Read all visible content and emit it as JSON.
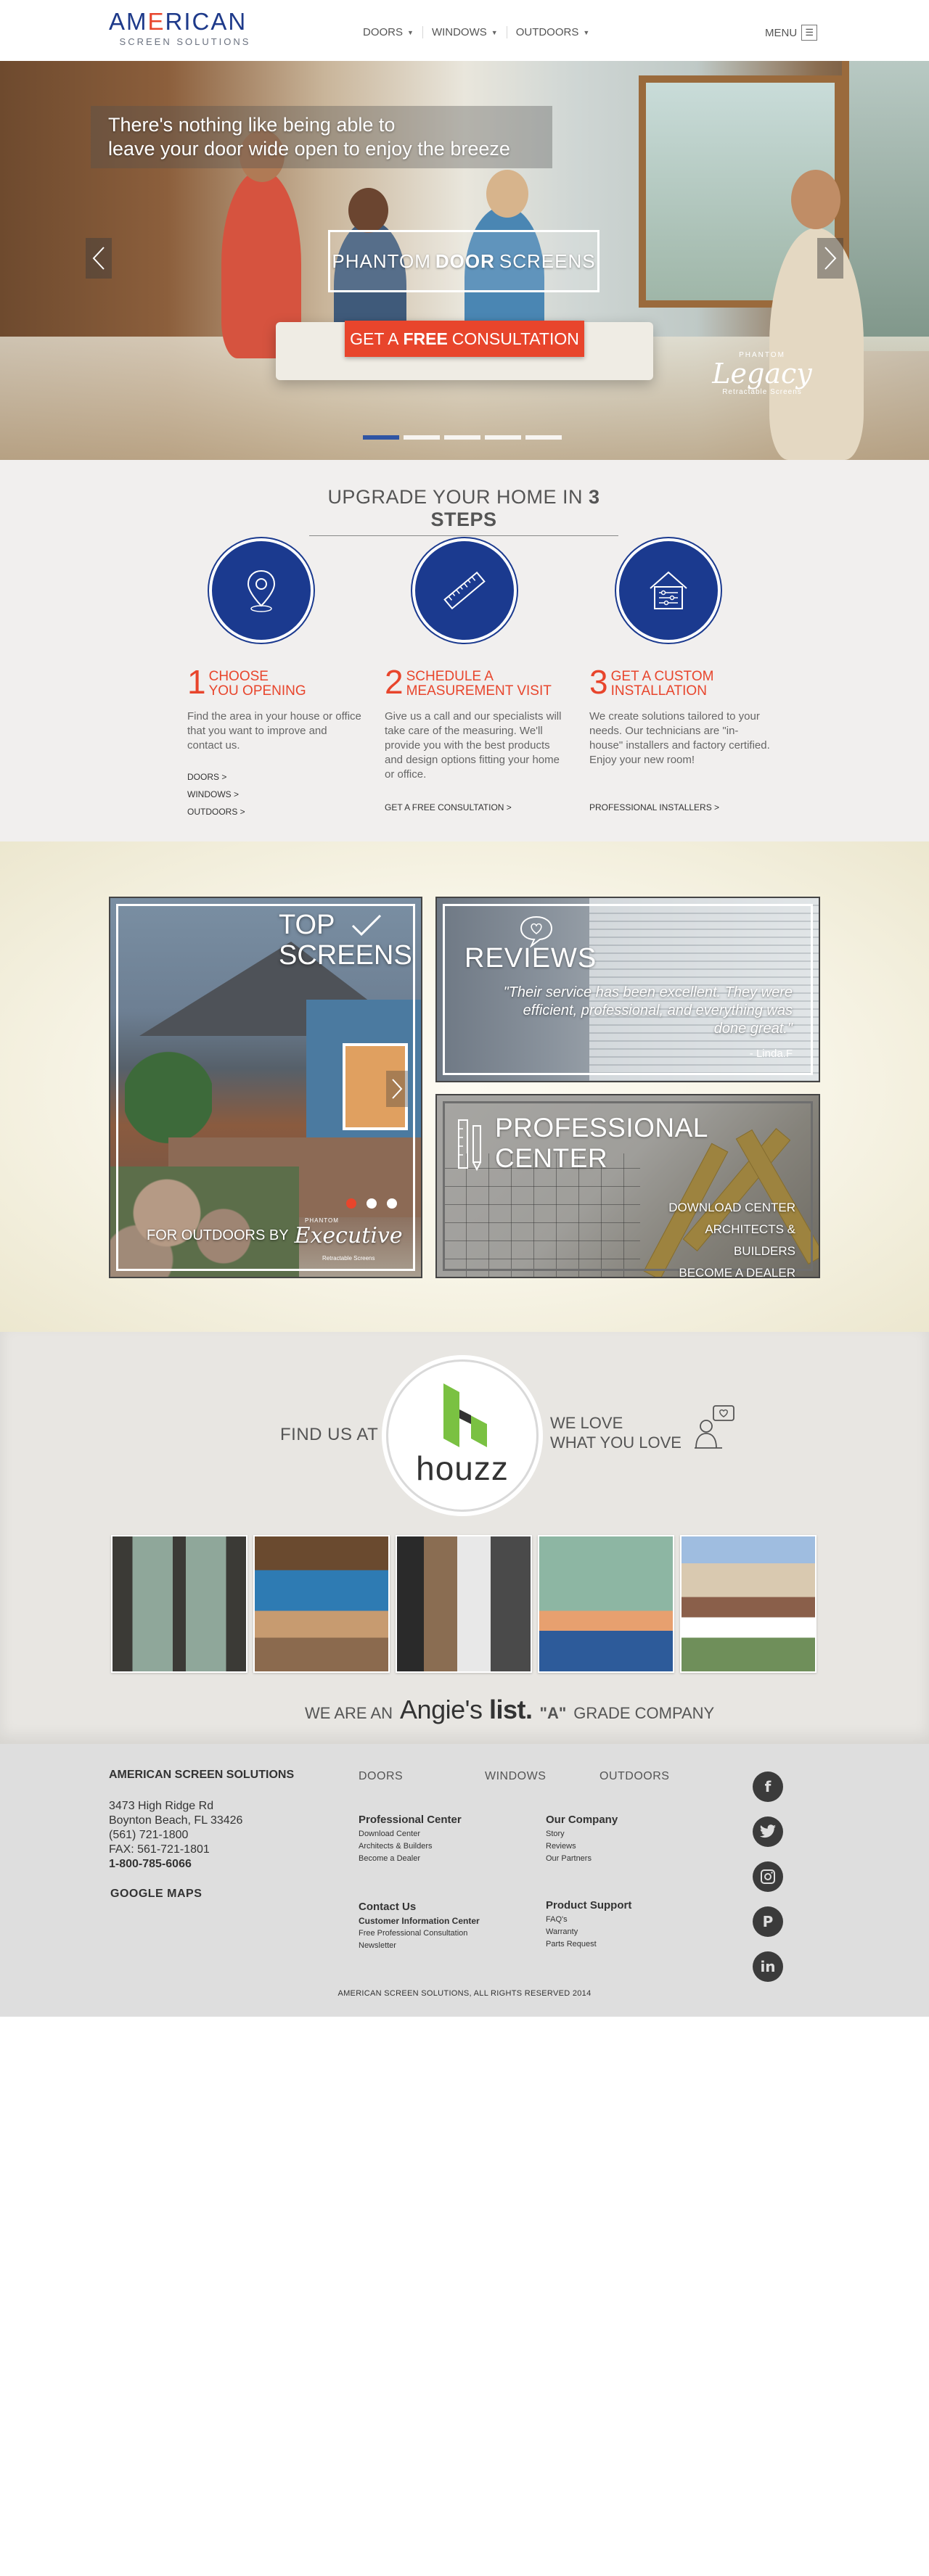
{
  "header": {
    "logo_main_a": "AM",
    "logo_main_e": "E",
    "logo_main_b": "RICAN",
    "logo_sub": "SCREEN SOLUTIONS",
    "nav": [
      "DOORS",
      "WINDOWS",
      "OUTDOORS"
    ],
    "menu_label": "MENU"
  },
  "hero": {
    "caption_line1": "There's nothing like being able to",
    "caption_line2": "leave your door wide open to enjoy the breeze",
    "boxed_a": "PHANTOM",
    "boxed_b": "DOOR",
    "boxed_c": "SCREENS",
    "cta_a": "GET A",
    "cta_b": "FREE",
    "cta_c": "CONSULTATION",
    "legacy_small": "PHANTOM",
    "legacy_big": "Legacy",
    "legacy_tag": "Retractable Screens",
    "slides_total": 5,
    "slide_active": 1
  },
  "steps": {
    "title_a": "UPGRADE YOUR HOME IN",
    "title_b": "3 STEPS",
    "items": [
      {
        "num": "1",
        "head_line1": "CHOOSE",
        "head_line2": "YOU OPENING",
        "desc": "Find the area in your house or office that you want to improve and contact us.",
        "links": [
          "DOORS >",
          "WINDOWS >",
          "OUTDOORS >"
        ],
        "icon": "location-pin-icon"
      },
      {
        "num": "2",
        "head_line1": "SCHEDULE  A",
        "head_line2": "MEASUREMENT VISIT",
        "desc": "Give us a call and our specialists will take care of the measuring. We'll provide you with the best products and design options fitting your home or office.",
        "links": [
          "GET A FREE CONSULTATION  >"
        ],
        "icon": "ruler-icon"
      },
      {
        "num": "3",
        "head_line1": "GET A CUSTOM",
        "head_line2": "INSTALLATION",
        "desc": "We create solutions tailored to your needs. Our technicians are \"in-house\" installers and factory certified. Enjoy your new room!",
        "links": [
          "PROFESSIONAL INSTALLERS >"
        ],
        "icon": "house-settings-icon"
      }
    ]
  },
  "tiles": {
    "top_title_line1": "TOP",
    "top_title_line2": "SCREENS",
    "top_footer": "FOR OUTDOORS BY",
    "exec_small": "PHANTOM",
    "exec_logo": "Executive",
    "exec_tag": "Retractable Screens",
    "top_slides_total": 3,
    "top_slide_active": 1,
    "reviews_title": "REVIEWS",
    "review_quote": "\"Their service has been excellent. They were efficient, professional, and everything was done great.\"",
    "review_author": "- Linda.F",
    "pro_title_line1": "PROFESSIONAL",
    "pro_title_line2": "CENTER",
    "pro_links": [
      "DOWNLOAD CENTER",
      "ARCHITECTS & BUILDERS",
      "BECOME A DEALER"
    ]
  },
  "houzz": {
    "find_us": "FIND US AT",
    "logo_text": "houzz",
    "we_love_line1": "WE LOVE",
    "we_love_line2": "WHAT YOU LOVE",
    "angies_pre": "WE ARE AN",
    "angies_logo_a": "Angie's",
    "angies_logo_b": "list.",
    "angies_grade": "\"A\"",
    "angies_post": "GRADE COMPANY"
  },
  "footer": {
    "company": "AMERICAN SCREEN SOLUTIONS",
    "address_line1": "3473 High Ridge Rd",
    "address_line2": "Boynton Beach, FL 33426",
    "phone1": "(561) 721-1800",
    "fax": "FAX: 561-721-1801",
    "phone_toll": "1-800-785-6066",
    "maps": "GOOGLE MAPS",
    "col_doors": "DOORS",
    "col_windows": "WINDOWS",
    "col_outdoors": "OUTDOORS",
    "group1": {
      "title": "Professional Center",
      "links": [
        "Download Center",
        "Architects & Builders",
        "Become a Dealer"
      ]
    },
    "group2": {
      "title": "Our Company",
      "links": [
        "Story",
        "Reviews",
        "Our Partners"
      ]
    },
    "group3": {
      "title": "Contact Us",
      "sub": "Customer Information Center",
      "links": [
        "Free Professional Consultation",
        "Newsletter"
      ]
    },
    "group4": {
      "title": "Product Support",
      "links": [
        "FAQ's",
        "Warranty",
        "Parts Request"
      ]
    },
    "social": [
      "facebook-icon",
      "twitter-icon",
      "instagram-icon",
      "pinterest-icon",
      "linkedin-icon"
    ],
    "copyright": "AMERICAN SCREEN SOLUTIONS, ALL RIGHTS RESERVED 2014"
  },
  "colors": {
    "brand_blue": "#1b3a8f",
    "accent_orange": "#e8452c"
  }
}
